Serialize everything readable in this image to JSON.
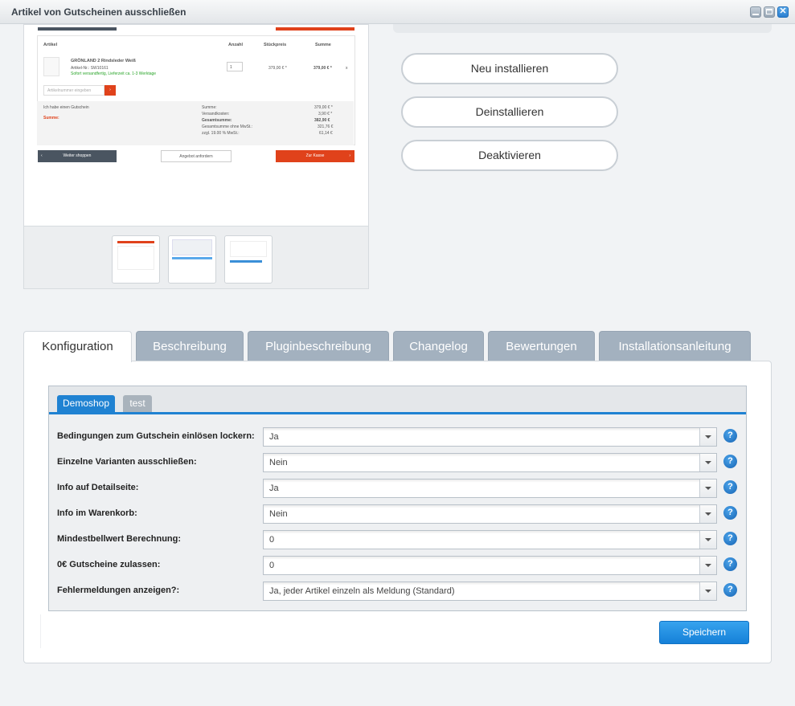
{
  "window": {
    "title": "Artikel von Gutscheinen ausschließen"
  },
  "preview": {
    "cart": {
      "col_article": "Artikel",
      "col_qty": "Anzahl",
      "col_unit_price": "Stückpreis",
      "col_sum": "Summe",
      "product_name": "GRÖNLAND 2 Rindsleder Weiß",
      "product_number": "Artikel-Nr.: SW10161",
      "delivery": "Sofort versandfertig, Lieferzeit ca. 1-3 Werktage",
      "qty": "1",
      "unit_price": "379,00 € *",
      "line_total": "379,00 € *",
      "remove": "x",
      "article_number_placeholder": "Artikelnummer eingeben",
      "add": "›",
      "voucher_checkbox": "Ich habe einen Gutschein",
      "shipping_costs_label": "Versandkosten :",
      "totals_labels": [
        "Summe:",
        "Versandkosten:",
        "Gesamtsumme:",
        "Gesamtsumme ohne MwSt.:",
        "zzgl. 19.00 % MwSt.:"
      ],
      "totals_values": [
        "379,00 € *",
        "3,90 € *",
        "382,90 €",
        "321,76 €",
        "61,14 €"
      ],
      "btn_continue": "Weiter shoppen",
      "btn_continue_icon": "‹",
      "btn_offer": "Angebot anfordern",
      "btn_checkout": "Zur Kasse",
      "btn_checkout_icon": "›"
    }
  },
  "actions": {
    "reinstall": "Neu installieren",
    "uninstall": "Deinstallieren",
    "deactivate": "Deaktivieren"
  },
  "tabs": [
    {
      "label": "Konfiguration"
    },
    {
      "label": "Beschreibung"
    },
    {
      "label": "Pluginbeschreibung"
    },
    {
      "label": "Changelog"
    },
    {
      "label": "Bewertungen"
    },
    {
      "label": "Installationsanleitung"
    }
  ],
  "shop_tabs": [
    {
      "label": "Demoshop"
    },
    {
      "label": "test"
    }
  ],
  "config": {
    "rows": [
      {
        "label": "Bedingungen zum Gutschein einlösen lockern:",
        "value": "Ja"
      },
      {
        "label": "Einzelne Varianten ausschließen:",
        "value": "Nein"
      },
      {
        "label": "Info auf Detailseite:",
        "value": "Ja"
      },
      {
        "label": "Info im Warenkorb:",
        "value": "Nein"
      },
      {
        "label": "Mindestbellwert Berechnung:",
        "value": "0"
      },
      {
        "label": "0€ Gutscheine zulassen:",
        "value": "0"
      },
      {
        "label": "Fehlermeldungen anzeigen?:",
        "value": "Ja, jeder Artikel einzeln als Meldung (Standard)"
      }
    ],
    "help_glyph": "?",
    "save_label": "Speichern"
  },
  "colors": {
    "accent": "#1f82d2",
    "tab_inactive": "#a3b1bf",
    "cart_orange": "#e0421b"
  }
}
